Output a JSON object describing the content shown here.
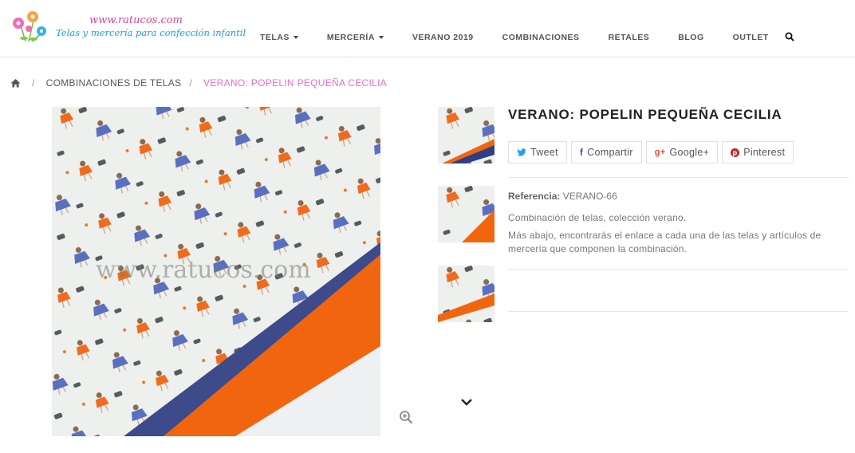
{
  "header": {
    "logo": {
      "site": "www.ratucos.com",
      "tagline": "Telas y mercería para confección infantil"
    },
    "nav": [
      {
        "label": "TELAS",
        "dropdown": true
      },
      {
        "label": "MERCERÍA",
        "dropdown": true
      },
      {
        "label": "VERANO 2019",
        "dropdown": false
      },
      {
        "label": "COMBINACIONES",
        "dropdown": false
      },
      {
        "label": "RETALES",
        "dropdown": false
      },
      {
        "label": "BLOG",
        "dropdown": false
      },
      {
        "label": "OUTLET",
        "dropdown": false
      }
    ],
    "search_icon": "search-icon"
  },
  "breadcrumb": {
    "home_icon": "home-icon",
    "separator": "/",
    "category": "COMBINACIONES DE TELAS",
    "current": "VERANO: POPELIN PEQUEÑA CECILIA"
  },
  "gallery": {
    "watermark": "www.ratucos.com",
    "zoom_icon": "zoom-in-icon",
    "scroll_icon": "chevron-down-icon",
    "thumbnail_count": 3
  },
  "product": {
    "title": "VERANO: POPELIN PEQUEÑA CECILIA",
    "share": {
      "tweet": "Tweet",
      "facebook": "Compartir",
      "google": "Google+",
      "pinterest": "Pinterest"
    },
    "reference_label": "Referencia:",
    "reference_value": "VERANO-66",
    "description": [
      "Combinación de telas, colección verano.",
      "Más abajo, encontrarás el enlace a cada una de las telas y artículos de mercería que componen la combinación."
    ]
  },
  "colors": {
    "accent_pink": "#e86bd0",
    "twitter": "#1da1f2",
    "facebook": "#3b5998",
    "google": "#dd4b39",
    "pinterest": "#cb2027",
    "fabric_orange": "#f26a1b",
    "fabric_blue": "#5a6fc0"
  }
}
